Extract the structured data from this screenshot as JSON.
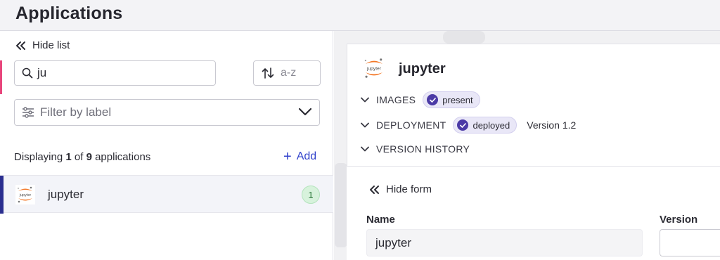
{
  "header": {
    "title": "Applications"
  },
  "left": {
    "hide_list_label": "Hide list",
    "search": {
      "value": "ju"
    },
    "sort": {
      "label": "a-z"
    },
    "filter": {
      "placeholder": "Filter by label"
    },
    "count": {
      "prefix": "Displaying ",
      "shown": "1",
      "middle": " of ",
      "total": "9",
      "suffix": " applications"
    },
    "add_label": "Add",
    "apps": [
      {
        "name": "jupyter",
        "badge": "1"
      }
    ]
  },
  "detail": {
    "title": "jupyter",
    "sections": {
      "images": {
        "label": "IMAGES",
        "status": "present"
      },
      "deployment": {
        "label": "DEPLOYMENT",
        "status": "deployed",
        "version": "Version 1.2"
      },
      "history": {
        "label": "VERSION HISTORY"
      }
    }
  },
  "form": {
    "hide_form_label": "Hide form",
    "name_label": "Name",
    "name_value": "jupyter",
    "version_label": "Version"
  },
  "colors": {
    "accent_pink": "#e8467c",
    "selected_accent": "#2a2e8f",
    "add_blue": "#3344cc",
    "status_purple": "#4b3aa6",
    "badge_green": "#d7f2dc"
  },
  "icons": {
    "hide_list": "double-chevron-left-icon",
    "search": "search-icon",
    "sort": "sort-arrows-icon",
    "filter": "sliders-icon",
    "dropdown": "chevron-down-icon",
    "add": "plus-icon",
    "app_logo": "jupyter-logo",
    "section_toggle": "chevron-down-icon",
    "status": "check-circle-icon"
  }
}
